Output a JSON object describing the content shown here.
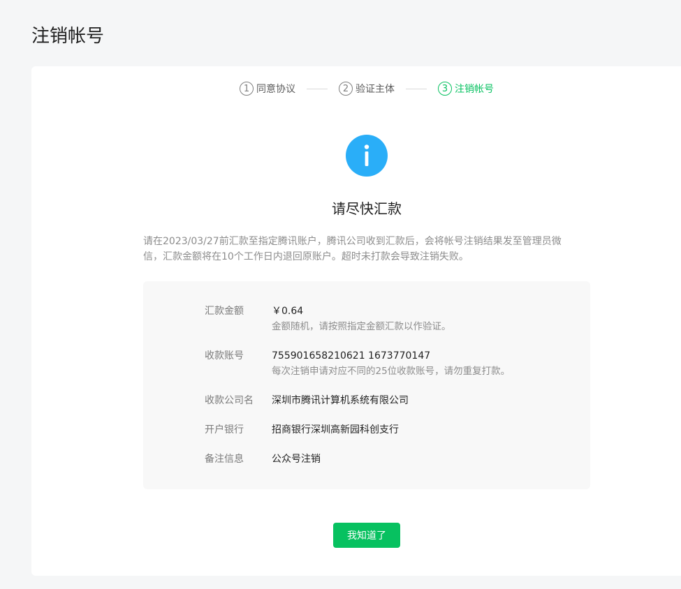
{
  "page": {
    "title": "注销帐号"
  },
  "steps": [
    {
      "num": "1",
      "label": "同意协议"
    },
    {
      "num": "2",
      "label": "验证主体"
    },
    {
      "num": "3",
      "label": "注销帐号"
    }
  ],
  "result": {
    "icon": "info-icon",
    "headline": "请尽快汇款",
    "description": "请在2023/03/27前汇款至指定腾讯账户，腾讯公司收到汇款后，会将帐号注销结果发至管理员微信，汇款金额将在10个工作日内退回原账户。超时未打款会导致注销失败。"
  },
  "details": {
    "amount": {
      "label": "汇款金额",
      "value": "￥0.64",
      "hint": "金额随机，请按照指定金额汇款以作验证。"
    },
    "account": {
      "label": "收款账号",
      "value": "755901658210621 1673770147",
      "hint": "每次注销申请对应不同的25位收款账号，请勿重复打款。"
    },
    "company": {
      "label": "收款公司名",
      "value": "深圳市腾讯计算机系统有限公司"
    },
    "bank": {
      "label": "开户银行",
      "value": "招商银行深圳高新园科创支行"
    },
    "remark": {
      "label": "备注信息",
      "value": "公众号注销"
    }
  },
  "actions": {
    "confirm_label": "我知道了"
  },
  "colors": {
    "accent": "#07c160",
    "info": "#2aaef8"
  }
}
